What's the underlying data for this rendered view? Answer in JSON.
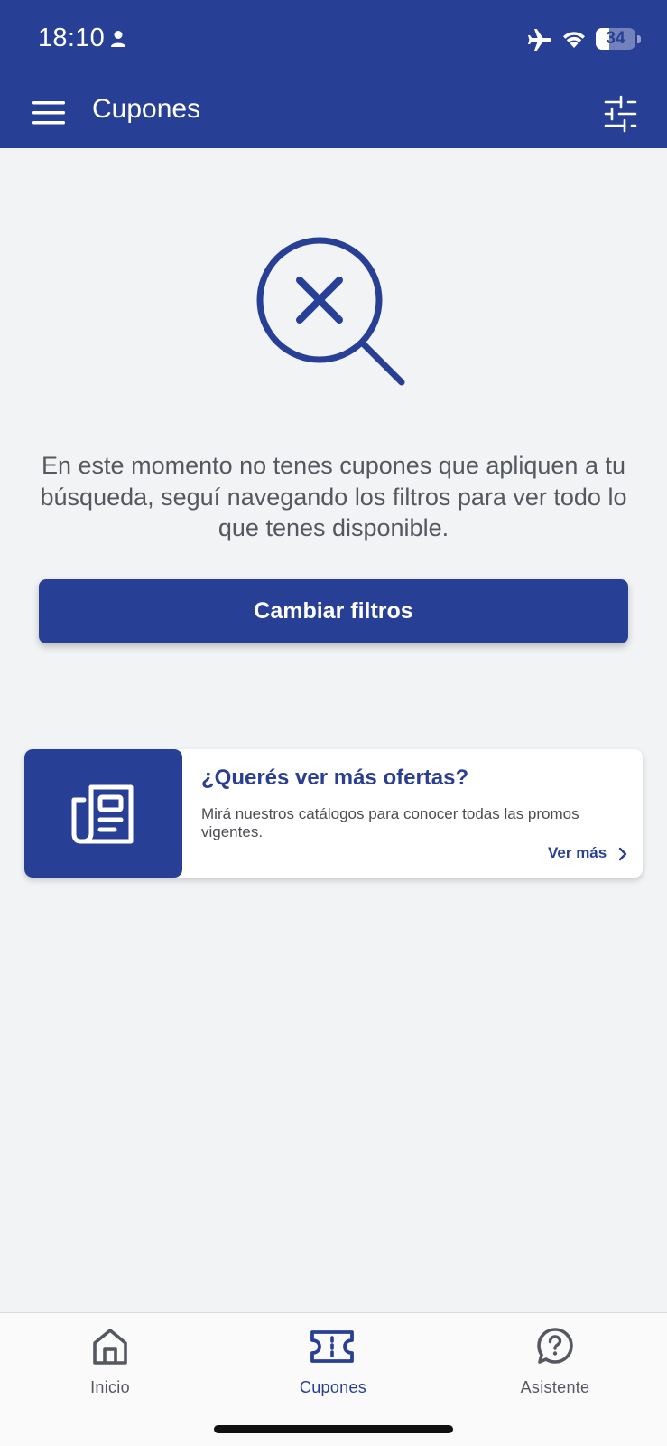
{
  "status_bar": {
    "time": "18:10",
    "battery": "34",
    "battery_level": 0.34,
    "icons": [
      "person-icon",
      "airplane-icon",
      "wifi-icon",
      "battery-icon"
    ]
  },
  "app_bar": {
    "title": "Cupones",
    "left_icon": "menu-icon",
    "right_icon": "filter-sliders-icon"
  },
  "empty_state": {
    "icon": "search-no-results-icon",
    "message": "En este momento no tenes cupones que apliquen a tu búsqueda, seguí navegando los filtros para ver todo lo que tenes disponible.",
    "button_label": "Cambiar filtros"
  },
  "promo": {
    "icon": "newspaper-icon",
    "title": "¿Querés ver más ofertas?",
    "text": "Mirá nuestros catálogos para conocer todas las promos vigentes.",
    "link_label": "Ver más"
  },
  "bottom_nav": {
    "items": [
      {
        "label": "Inicio",
        "icon": "home-icon",
        "active": false
      },
      {
        "label": "Cupones",
        "icon": "ticket-icon",
        "active": true
      },
      {
        "label": "Asistente",
        "icon": "help-chat-icon",
        "active": false
      }
    ]
  },
  "colors": {
    "primary": "#283f96",
    "background": "#f2f3f5",
    "text": "#55585e"
  }
}
